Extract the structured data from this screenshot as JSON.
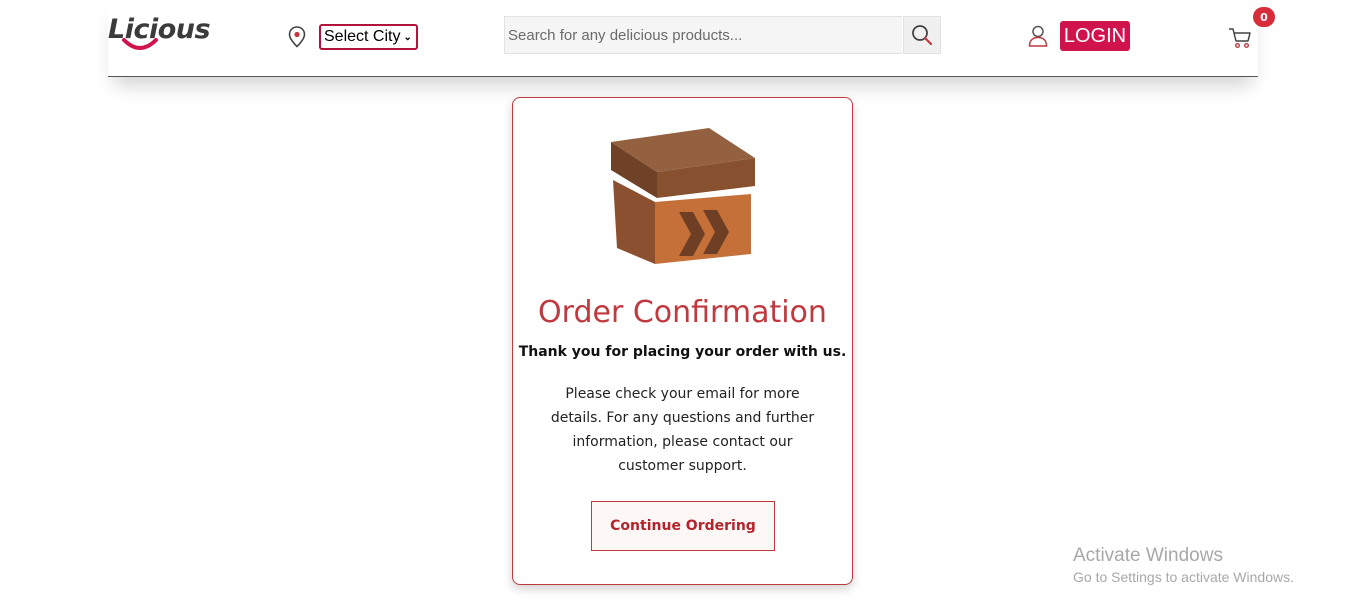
{
  "header": {
    "logo_text": "Licious",
    "city_select": {
      "selected": "Select City"
    },
    "search": {
      "placeholder": "Search for any delicious products..."
    },
    "login_label": "LOGIN",
    "cart_count": "0"
  },
  "confirmation": {
    "title": "Order Confirmation",
    "thanks": "Thank you for placing your order with us.",
    "message": "Please check your email for more details. For any questions and further information, please contact our customer support.",
    "continue_label": "Continue Ordering"
  },
  "os_watermark": {
    "title": "Activate Windows",
    "subtitle": "Go to Settings to activate Windows."
  },
  "colors": {
    "brand": "#d1134d",
    "accent": "#c0393f"
  },
  "icons": [
    "location-pin-icon",
    "chevron-down-icon",
    "search-icon",
    "user-icon",
    "cart-icon",
    "package-box-icon"
  ]
}
